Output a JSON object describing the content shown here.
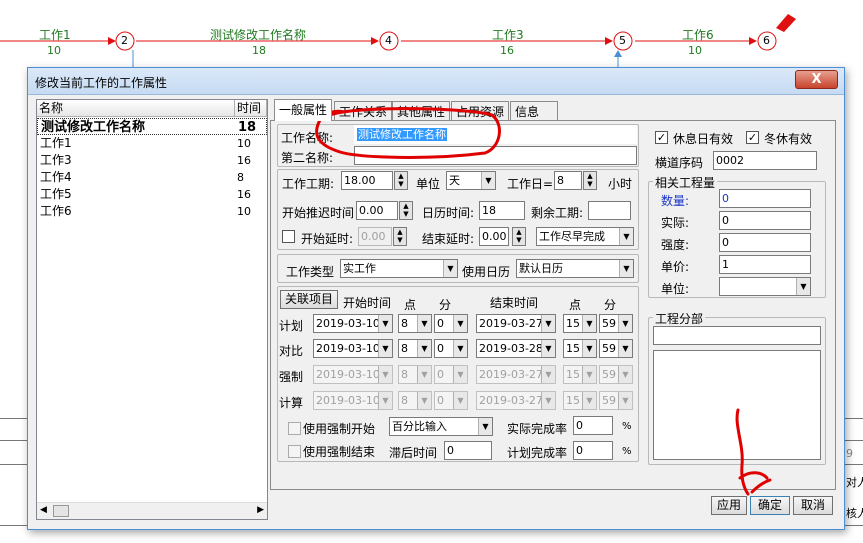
{
  "network": {
    "tasks": [
      {
        "name": "工作1",
        "duration": "10"
      },
      {
        "name": "测试修改工作名称",
        "duration": "18"
      },
      {
        "name": "工作3",
        "duration": "16"
      },
      {
        "name": "工作6",
        "duration": "10"
      }
    ],
    "nodes": [
      "2",
      "4",
      "5",
      "6"
    ]
  },
  "background": {
    "right_text_1": "对人",
    "right_text_2": "核人",
    "right_digit": "9"
  },
  "dialog": {
    "title": "修改当前工作的工作属性",
    "close_label": "X"
  },
  "list": {
    "col_name": "名称",
    "col_time": "时间",
    "rows": [
      {
        "name": "测试修改工作名称",
        "time": "18"
      },
      {
        "name": "工作1",
        "time": "10"
      },
      {
        "name": "工作3",
        "time": "16"
      },
      {
        "name": "工作4",
        "time": "8"
      },
      {
        "name": "工作5",
        "time": "16"
      },
      {
        "name": "工作6",
        "time": "10"
      }
    ]
  },
  "tabs": [
    "一般属性",
    "工作关系",
    "其他属性",
    "占用资源",
    "信息"
  ],
  "general": {
    "work_name_label": "工作名称:",
    "work_name_value": "测试修改工作名称",
    "second_name_label": "第二名称:",
    "second_name_value": "",
    "duration_label": "工作工期:",
    "duration_value": "18.00",
    "unit_label": "单位",
    "unit_value": "天",
    "workday_label": "工作日=",
    "workday_value": "8",
    "hours_label": "小时",
    "start_delay_label": "开始推迟时间",
    "start_delay_value": "0.00",
    "calendar_time_label": "日历时间:",
    "calendar_time_value": "18",
    "remaining_label": "剩余工期:",
    "remaining_value": "",
    "start_lag_label": "开始延时:",
    "start_lag_value": "0.00",
    "end_lag_label": "结束延时:",
    "end_lag_value": "0.00",
    "finish_mode": "工作尽早完成",
    "work_type_label": "工作类型",
    "work_type_value": "实工作",
    "calendar_label": "使用日历",
    "calendar_value": "默认日历"
  },
  "schedule": {
    "link_button": "关联项目",
    "start_time": "开始时间",
    "end_time": "结束时间",
    "hour": "点",
    "minute": "分",
    "rows": [
      {
        "label": "计划",
        "start_date": "2019-03-10",
        "start_h": "8",
        "start_m": "0",
        "end_date": "2019-03-27",
        "end_h": "15",
        "end_m": "59",
        "disabled": false
      },
      {
        "label": "对比",
        "start_date": "2019-03-10",
        "start_h": "8",
        "start_m": "0",
        "end_date": "2019-03-28",
        "end_h": "15",
        "end_m": "59",
        "disabled": false
      },
      {
        "label": "强制",
        "start_date": "2019-03-10",
        "start_h": "8",
        "start_m": "0",
        "end_date": "2019-03-27",
        "end_h": "15",
        "end_m": "59",
        "disabled": true
      },
      {
        "label": "计算",
        "start_date": "2019-03-10",
        "start_h": "8",
        "start_m": "0",
        "end_date": "2019-03-27",
        "end_h": "15",
        "end_m": "59",
        "disabled": true
      }
    ],
    "force_start_label": "使用强制开始",
    "force_end_label": "使用强制结束",
    "percent_mode": "百分比输入",
    "actual_rate_label": "实际完成率",
    "actual_rate_value": "0",
    "lag_time_label": "滞后时间",
    "lag_time_value": "0",
    "plan_rate_label": "计划完成率",
    "plan_rate_value": "0",
    "percent_sign": "%"
  },
  "right": {
    "holiday_label": "休息日有效",
    "winter_label": "冬休有效",
    "tunnel_label": "横道序码",
    "tunnel_value": "0002",
    "quantity_group": "相关工程量",
    "quantity_label": "数量:",
    "quantity_value": "0",
    "actual_label": "实际:",
    "actual_value": "0",
    "intensity_label": "强度:",
    "intensity_value": "0",
    "price_label": "单价:",
    "price_value": "1",
    "unit_label": "单位:",
    "unit_value": "",
    "division_group": "工程分部",
    "division_value": ""
  },
  "buttons": {
    "apply": "应用",
    "ok": "确定",
    "cancel": "取消"
  },
  "colors": {
    "task_text": "#1f7a1f",
    "arrow": "#e01010",
    "annotation": "#e00000",
    "selection": "#3399ff"
  }
}
